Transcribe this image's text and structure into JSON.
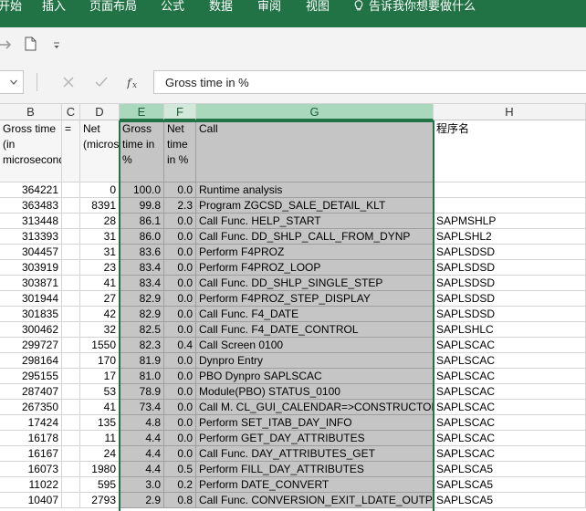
{
  "ribbon": {
    "tabs": [
      "开始",
      "插入",
      "页面布局",
      "公式",
      "数据",
      "审阅",
      "视图"
    ],
    "tell_me": "告诉我你想要做什么"
  },
  "formula_bar": {
    "value": "Gross time in %"
  },
  "columns": [
    "B",
    "C",
    "D",
    "E",
    "F",
    "G",
    "H"
  ],
  "header_row": {
    "B": "Gross time (in microseconds)",
    "C": "=",
    "D": "Net (microseconds)",
    "E": "Gross time in %",
    "F": "Net time in %",
    "G": "Call",
    "H": "程序名"
  },
  "rows": [
    {
      "b": "364221",
      "d": "0",
      "e": "100.0",
      "f": "0.0",
      "g": "Runtime analysis",
      "h": ""
    },
    {
      "b": "363483",
      "d": "8391",
      "e": "99.8",
      "f": "2.3",
      "g": "Program ZGCSD_SALE_DETAIL_KLT",
      "h": ""
    },
    {
      "b": "313448",
      "d": "28",
      "e": "86.1",
      "f": "0.0",
      "g": "Call Func. HELP_START",
      "h": "SAPMSHLP"
    },
    {
      "b": "313393",
      "d": "31",
      "e": "86.0",
      "f": "0.0",
      "g": "Call Func. DD_SHLP_CALL_FROM_DYNP",
      "h": "SAPLSHL2"
    },
    {
      "b": "304457",
      "d": "31",
      "e": "83.6",
      "f": "0.0",
      "g": "Perform F4PROZ",
      "h": "SAPLSDSD"
    },
    {
      "b": "303919",
      "d": "23",
      "e": "83.4",
      "f": "0.0",
      "g": "Perform F4PROZ_LOOP",
      "h": "SAPLSDSD"
    },
    {
      "b": "303871",
      "d": "41",
      "e": "83.4",
      "f": "0.0",
      "g": "Call Func. DD_SHLP_SINGLE_STEP",
      "h": "SAPLSDSD"
    },
    {
      "b": "301944",
      "d": "27",
      "e": "82.9",
      "f": "0.0",
      "g": "Perform F4PROZ_STEP_DISPLAY",
      "h": "SAPLSDSD"
    },
    {
      "b": "301835",
      "d": "42",
      "e": "82.9",
      "f": "0.0",
      "g": "Call Func. F4_DATE",
      "h": "SAPLSDSD"
    },
    {
      "b": "300462",
      "d": "32",
      "e": "82.5",
      "f": "0.0",
      "g": "Call Func. F4_DATE_CONTROL",
      "h": "SAPLSHLC"
    },
    {
      "b": "299727",
      "d": "1550",
      "e": "82.3",
      "f": "0.4",
      "g": "Call Screen 0100",
      "h": "SAPLSCAC"
    },
    {
      "b": "298164",
      "d": "170",
      "e": "81.9",
      "f": "0.0",
      "g": "Dynpro Entry",
      "h": "SAPLSCAC"
    },
    {
      "b": "295155",
      "d": "17",
      "e": "81.0",
      "f": "0.0",
      "g": "PBO Dynpro SAPLSCAC",
      "h": "SAPLSCAC"
    },
    {
      "b": "287407",
      "d": "53",
      "e": "78.9",
      "f": "0.0",
      "g": "Module(PBO) STATUS_0100",
      "h": "SAPLSCAC"
    },
    {
      "b": "267350",
      "d": "41",
      "e": "73.4",
      "f": "0.0",
      "g": "Call M. CL_GUI_CALENDAR=>CONSTRUCTOR",
      "h": "SAPLSCAC"
    },
    {
      "b": "17424",
      "d": "135",
      "e": "4.8",
      "f": "0.0",
      "g": "Perform SET_ITAB_DAY_INFO",
      "h": "SAPLSCAC"
    },
    {
      "b": "16178",
      "d": "11",
      "e": "4.4",
      "f": "0.0",
      "g": "Perform GET_DAY_ATTRIBUTES",
      "h": "SAPLSCAC"
    },
    {
      "b": "16167",
      "d": "24",
      "e": "4.4",
      "f": "0.0",
      "g": "Call Func. DAY_ATTRIBUTES_GET",
      "h": "SAPLSCAC"
    },
    {
      "b": "16073",
      "d": "1980",
      "e": "4.4",
      "f": "0.5",
      "g": "Perform FILL_DAY_ATTRIBUTES",
      "h": "SAPLSCA5"
    },
    {
      "b": "11022",
      "d": "595",
      "e": "3.0",
      "f": "0.2",
      "g": "Perform DATE_CONVERT",
      "h": "SAPLSCA5"
    },
    {
      "b": "10407",
      "d": "2793",
      "e": "2.9",
      "f": "0.8",
      "g": "Call Func. CONVERSION_EXIT_LDATE_OUTPUT",
      "h": "SAPLSCA5"
    }
  ]
}
